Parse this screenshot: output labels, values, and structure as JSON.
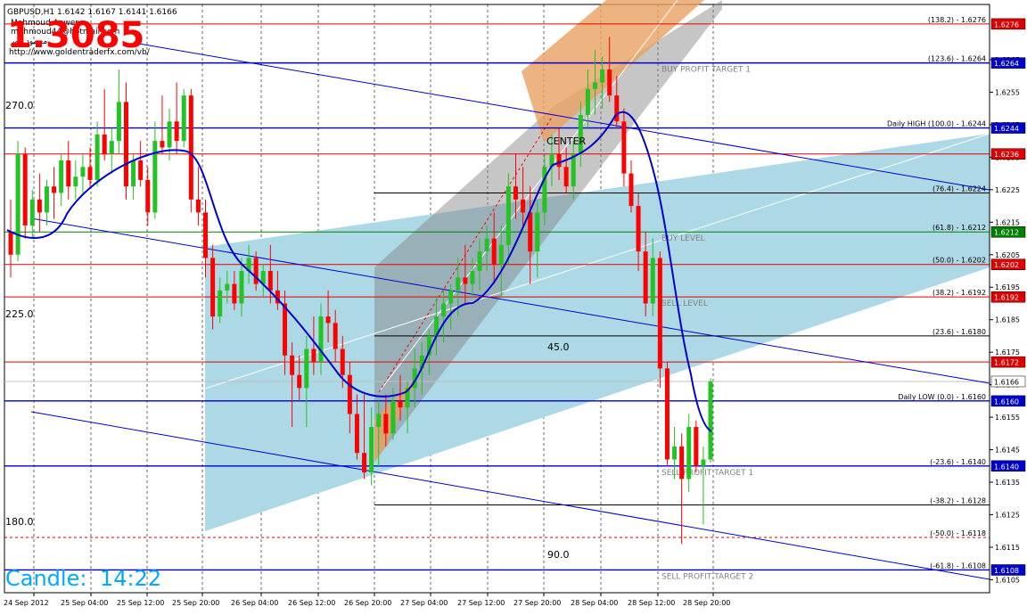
{
  "header": {
    "symbol_line": "GBPUSD,H1  1.6142 1.6167 1.6141 1.6166",
    "author_name": "Mahmoud Anwer",
    "author_email": "mahmoud44@hotmail.com",
    "author_arabic": "محمود انور",
    "website": "http://www.goldentraderfx.com/vb/",
    "big_number": "1.3085",
    "candle_timer_label": "Candle:",
    "candle_timer_value": "14:22"
  },
  "colors": {
    "bull": "#22c322",
    "bear": "#ff0000",
    "ma_line": "#0000cc",
    "channel_fill": "#add8e6",
    "inner_channel": "#808080",
    "orange_band": "#e8a060",
    "support_red": "#e00000",
    "support_blue": "#0000cc",
    "big_number": "#ff0000",
    "timer": "#00aaff"
  },
  "chart_data": {
    "type": "candlestick",
    "ylim": [
      1.6101,
      1.6282
    ],
    "y_ticks": [
      1.6105,
      1.6115,
      1.6125,
      1.6135,
      1.6145,
      1.6155,
      1.6165,
      1.6175,
      1.6185,
      1.6195,
      1.6205,
      1.6215,
      1.6225,
      1.6235,
      1.6245,
      1.6255,
      1.6265
    ],
    "y_tick_labels": [
      "1.6105",
      "1.6115",
      "1.6125",
      "1.6135",
      "1.6145",
      "1.6155",
      "1.6165",
      "1.6175",
      "1.6185",
      "1.6195",
      "1.6205",
      "1.6215",
      "1.6225",
      "1.6235",
      "1.6245",
      "1.6255",
      "1.6265"
    ],
    "x_labels": [
      "24 Sep 2012",
      "25 Sep 04:00",
      "25 Sep 12:00",
      "25 Sep 20:00",
      "26 Sep 04:00",
      "26 Sep 12:00",
      "26 Sep 20:00",
      "27 Sep 04:00",
      "27 Sep 12:00",
      "27 Sep 20:00",
      "28 Sep 04:00",
      "28 Sep 12:00",
      "28 Sep 20:00"
    ],
    "price_levels": [
      {
        "name": "level-1-6276",
        "price": 1.6276,
        "color": "red",
        "badge": "1.6276",
        "label": "(138.2) - 1.6276",
        "extra": ""
      },
      {
        "name": "level-1-6264",
        "price": 1.6264,
        "color": "blue",
        "badge": "1.6264",
        "label": "(123.6) - 1.6264",
        "extra": "BUY PROFIT TARGET 1"
      },
      {
        "name": "level-1-6244",
        "price": 1.6244,
        "color": "blue",
        "badge": "1.6244",
        "label": "Daily HIGH (100.0) - 1.6244",
        "extra": ""
      },
      {
        "name": "level-1-6236",
        "price": 1.6236,
        "color": "red",
        "badge": "1.6236",
        "label": "",
        "extra": ""
      },
      {
        "name": "level-1-6224",
        "price": 1.6224,
        "color": "black",
        "badge": "",
        "label": "(76.4) - 1.6224",
        "extra": ""
      },
      {
        "name": "level-1-6212",
        "price": 1.6212,
        "color": "green",
        "badge": "1.6212",
        "label": "(61.8) - 1.6212",
        "extra": "BUY LEVEL"
      },
      {
        "name": "level-1-6202",
        "price": 1.6202,
        "color": "red",
        "badge": "1.6202",
        "label": "(50.0) - 1.6202",
        "extra": ""
      },
      {
        "name": "level-1-6192",
        "price": 1.6192,
        "color": "red",
        "badge": "1.6192",
        "label": "(38.2) - 1.6192",
        "extra": "SELL LEVEL"
      },
      {
        "name": "level-1-6180",
        "price": 1.618,
        "color": "black",
        "badge": "",
        "label": "(23.6) - 1.6180",
        "extra": ""
      },
      {
        "name": "level-1-6172",
        "price": 1.6172,
        "color": "red",
        "badge": "1.6172",
        "label": "",
        "extra": ""
      },
      {
        "name": "level-1-6166",
        "price": 1.6166,
        "color": "white",
        "badge": "1.6166",
        "label": "",
        "extra": ""
      },
      {
        "name": "level-1-6160",
        "price": 1.616,
        "color": "blue",
        "badge": "1.6160",
        "label": "Daily LOW (0.0) - 1.6160",
        "extra": ""
      },
      {
        "name": "level-1-6140",
        "price": 1.614,
        "color": "blue",
        "badge": "1.6140",
        "label": "(-23.6) - 1.6140",
        "extra": "SELL PROFIT TARGET 1"
      },
      {
        "name": "level-1-6128",
        "price": 1.6128,
        "color": "black",
        "badge": "",
        "label": "(-38.2) - 1.6128",
        "extra": ""
      },
      {
        "name": "level-1-6118",
        "price": 1.6118,
        "color": "red",
        "badge": "",
        "label": "(-50.0) - 1.6118",
        "extra": ""
      },
      {
        "name": "level-1-6108",
        "price": 1.6108,
        "color": "blue",
        "badge": "1.6108",
        "label": "(-61.8) - 1.6108",
        "extra": "SELL PROFIT TARGET 2"
      }
    ],
    "angle_labels": [
      "270.0",
      "225.0",
      "180.0"
    ],
    "gann_labels": [
      "45.0",
      "90.0"
    ],
    "center_label": "CENTER",
    "candles": [
      [
        1.6212,
        1.6222,
        1.6198,
        1.6205
      ],
      [
        1.6205,
        1.624,
        1.6203,
        1.6236
      ],
      [
        1.6236,
        1.6238,
        1.621,
        1.6214
      ],
      [
        1.6214,
        1.6225,
        1.621,
        1.6222
      ],
      [
        1.6222,
        1.623,
        1.6212,
        1.6218
      ],
      [
        1.6218,
        1.6228,
        1.6214,
        1.6226
      ],
      [
        1.6226,
        1.6232,
        1.6216,
        1.6224
      ],
      [
        1.6224,
        1.6236,
        1.622,
        1.6234
      ],
      [
        1.6234,
        1.624,
        1.6222,
        1.6226
      ],
      [
        1.6226,
        1.6234,
        1.6222,
        1.6229
      ],
      [
        1.6229,
        1.6236,
        1.6224,
        1.6232
      ],
      [
        1.6232,
        1.6238,
        1.6226,
        1.6228
      ],
      [
        1.6228,
        1.6246,
        1.6226,
        1.6242
      ],
      [
        1.6242,
        1.6256,
        1.6234,
        1.6236
      ],
      [
        1.6236,
        1.6244,
        1.623,
        1.624
      ],
      [
        1.624,
        1.6262,
        1.6236,
        1.6252
      ],
      [
        1.6252,
        1.6258,
        1.6222,
        1.6226
      ],
      [
        1.6226,
        1.6236,
        1.6222,
        1.6234
      ],
      [
        1.6234,
        1.624,
        1.6226,
        1.6228
      ],
      [
        1.6228,
        1.6232,
        1.6214,
        1.6218
      ],
      [
        1.6218,
        1.6246,
        1.6216,
        1.624
      ],
      [
        1.624,
        1.6254,
        1.6236,
        1.6238
      ],
      [
        1.6238,
        1.625,
        1.6234,
        1.6246
      ],
      [
        1.6246,
        1.6258,
        1.6236,
        1.624
      ],
      [
        1.624,
        1.6256,
        1.6238,
        1.6254
      ],
      [
        1.6254,
        1.6256,
        1.6218,
        1.6222
      ],
      [
        1.6222,
        1.6232,
        1.6214,
        1.6218
      ],
      [
        1.6218,
        1.6222,
        1.6198,
        1.6204
      ],
      [
        1.6204,
        1.6208,
        1.6182,
        1.6186
      ],
      [
        1.6186,
        1.6198,
        1.6184,
        1.6194
      ],
      [
        1.6194,
        1.62,
        1.619,
        1.6196
      ],
      [
        1.6196,
        1.62,
        1.6188,
        1.619
      ],
      [
        1.619,
        1.6204,
        1.6186,
        1.62
      ],
      [
        1.62,
        1.6208,
        1.6196,
        1.6204
      ],
      [
        1.6204,
        1.6206,
        1.6194,
        1.6196
      ],
      [
        1.6196,
        1.6202,
        1.6192,
        1.62
      ],
      [
        1.62,
        1.6208,
        1.619,
        1.6194
      ],
      [
        1.6194,
        1.62,
        1.6188,
        1.619
      ],
      [
        1.619,
        1.6194,
        1.6168,
        1.6174
      ],
      [
        1.6174,
        1.6178,
        1.6152,
        1.6168
      ],
      [
        1.6168,
        1.6174,
        1.616,
        1.6164
      ],
      [
        1.6164,
        1.618,
        1.6152,
        1.6176
      ],
      [
        1.6176,
        1.6186,
        1.6168,
        1.6172
      ],
      [
        1.6172,
        1.619,
        1.6168,
        1.6186
      ],
      [
        1.6186,
        1.6194,
        1.6178,
        1.6184
      ],
      [
        1.6184,
        1.6188,
        1.6172,
        1.6176
      ],
      [
        1.6176,
        1.618,
        1.6164,
        1.6168
      ],
      [
        1.6168,
        1.6172,
        1.615,
        1.6156
      ],
      [
        1.6156,
        1.6162,
        1.6142,
        1.6144
      ],
      [
        1.6144,
        1.6162,
        1.6136,
        1.6138
      ],
      [
        1.6138,
        1.6158,
        1.6134,
        1.6152
      ],
      [
        1.6152,
        1.616,
        1.614,
        1.6156
      ],
      [
        1.6156,
        1.6162,
        1.6146,
        1.615
      ],
      [
        1.615,
        1.6164,
        1.6148,
        1.616
      ],
      [
        1.616,
        1.6168,
        1.6154,
        1.6158
      ],
      [
        1.6158,
        1.6166,
        1.615,
        1.6164
      ],
      [
        1.6164,
        1.6176,
        1.6158,
        1.617
      ],
      [
        1.617,
        1.6178,
        1.6162,
        1.6174
      ],
      [
        1.6174,
        1.6182,
        1.6168,
        1.618
      ],
      [
        1.618,
        1.6192,
        1.6174,
        1.6186
      ],
      [
        1.6186,
        1.6194,
        1.6178,
        1.619
      ],
      [
        1.619,
        1.6196,
        1.6182,
        1.6194
      ],
      [
        1.6194,
        1.6204,
        1.6186,
        1.6198
      ],
      [
        1.6198,
        1.6208,
        1.619,
        1.6196
      ],
      [
        1.6196,
        1.6204,
        1.6192,
        1.62
      ],
      [
        1.62,
        1.621,
        1.6194,
        1.6206
      ],
      [
        1.6206,
        1.6214,
        1.62,
        1.621
      ],
      [
        1.621,
        1.6218,
        1.6196,
        1.6202
      ],
      [
        1.6202,
        1.6214,
        1.6192,
        1.6208
      ],
      [
        1.6208,
        1.623,
        1.6202,
        1.6226
      ],
      [
        1.6226,
        1.6236,
        1.6216,
        1.6222
      ],
      [
        1.6222,
        1.6232,
        1.6214,
        1.6218
      ],
      [
        1.6218,
        1.6226,
        1.6196,
        1.6206
      ],
      [
        1.6206,
        1.6222,
        1.6198,
        1.6218
      ],
      [
        1.6218,
        1.6236,
        1.6214,
        1.6232
      ],
      [
        1.6232,
        1.6242,
        1.6226,
        1.6236
      ],
      [
        1.6236,
        1.6244,
        1.6228,
        1.6232
      ],
      [
        1.6232,
        1.6238,
        1.6224,
        1.6226
      ],
      [
        1.6226,
        1.624,
        1.6222,
        1.6236
      ],
      [
        1.6236,
        1.6252,
        1.6232,
        1.6248
      ],
      [
        1.6248,
        1.6262,
        1.6244,
        1.6256
      ],
      [
        1.6256,
        1.6268,
        1.6248,
        1.6258
      ],
      [
        1.6258,
        1.6266,
        1.625,
        1.6262
      ],
      [
        1.6262,
        1.6272,
        1.6252,
        1.6254
      ],
      [
        1.6254,
        1.626,
        1.6244,
        1.6246
      ],
      [
        1.6246,
        1.625,
        1.6226,
        1.623
      ],
      [
        1.623,
        1.6234,
        1.6218,
        1.622
      ],
      [
        1.622,
        1.6224,
        1.62,
        1.6206
      ],
      [
        1.6206,
        1.6212,
        1.6186,
        1.619
      ],
      [
        1.619,
        1.621,
        1.6186,
        1.6204
      ],
      [
        1.6204,
        1.6206,
        1.6164,
        1.617
      ],
      [
        1.617,
        1.6172,
        1.614,
        1.6142
      ],
      [
        1.6142,
        1.6152,
        1.6136,
        1.6146
      ],
      [
        1.6146,
        1.615,
        1.6116,
        1.6136
      ],
      [
        1.6136,
        1.6156,
        1.6132,
        1.6152
      ],
      [
        1.6152,
        1.6154,
        1.6138,
        1.614
      ],
      [
        1.614,
        1.6146,
        1.6122,
        1.6142
      ],
      [
        1.6142,
        1.6167,
        1.6141,
        1.6166
      ]
    ]
  }
}
